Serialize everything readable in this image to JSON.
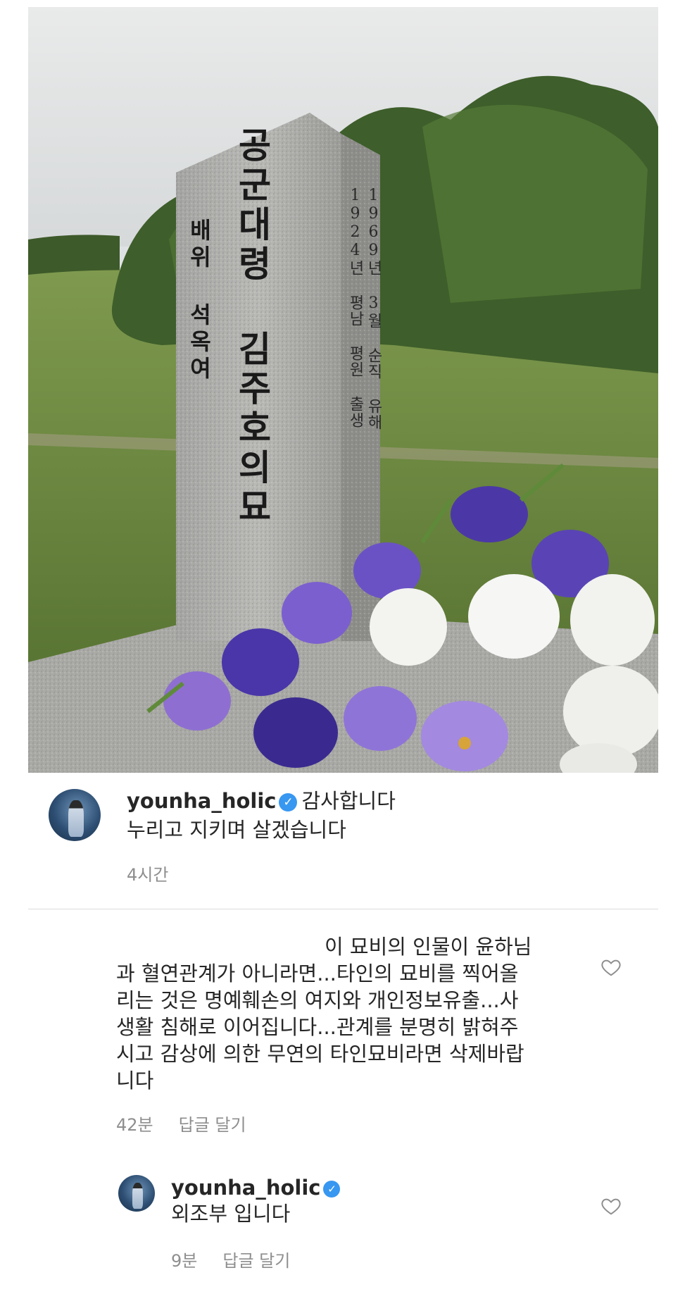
{
  "photo": {
    "stone_main": "공군대령 김주호의묘",
    "stone_side": "배위 석옥여",
    "stone_col1": "1924년 평남 평원 출생",
    "stone_col2": "1969년 3월 순직 유해"
  },
  "post_caption": {
    "username": "younha_holic",
    "line1": "감사합니다",
    "line2": "누리고 지키며 살겠습니다",
    "time": "4시간"
  },
  "comment": {
    "text_lines": [
      "이 묘비의 인물이 윤하님",
      "과 혈연관계가 아니라면...타인의 묘비를 찍어올",
      "리는 것은 명예훼손의 여지와 개인정보유출...사",
      "생활 침해로 이어집니다...관계를 분명히 밝혀주",
      "시고 감상에 의한 무연의 타인묘비라면 삭제바랍",
      "니다"
    ],
    "time": "42분",
    "reply_label": "답글 달기"
  },
  "reply": {
    "username": "younha_holic",
    "text": "외조부 입니다",
    "time": "9분",
    "reply_label": "답글 달기"
  },
  "icons": {
    "verified": "verified-badge-icon",
    "like": "heart-icon"
  },
  "colors": {
    "verified": "#3897f0",
    "meta_text": "#8e8e8e",
    "text": "#262626"
  }
}
